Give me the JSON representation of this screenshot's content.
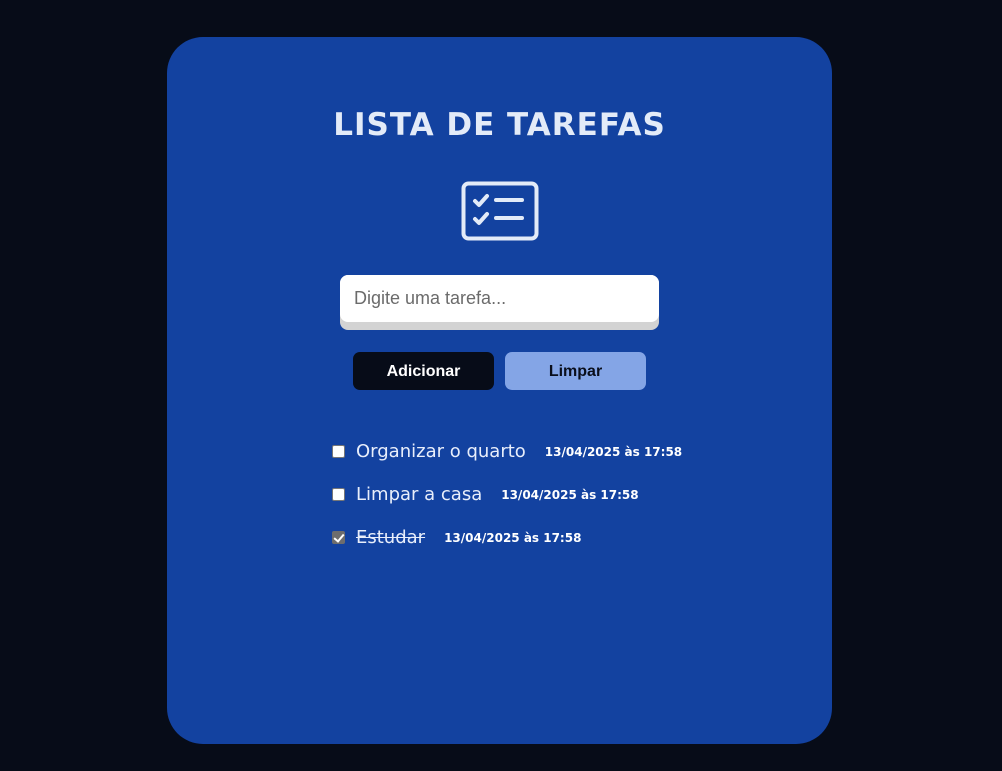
{
  "header": {
    "title": "LISTA DE TAREFAS"
  },
  "logo": {
    "icon": "checklist-icon",
    "color": "#e3ebf8"
  },
  "input": {
    "placeholder": "Digite uma tarefa...",
    "value": ""
  },
  "buttons": {
    "add_label": "Adicionar",
    "clear_label": "Limpar"
  },
  "tasks": [
    {
      "text": "Organizar o quarto",
      "date": "13/04/2025 às 17:58",
      "done": false
    },
    {
      "text": "Limpar a casa",
      "date": "13/04/2025 às 17:58",
      "done": false
    },
    {
      "text": "Estudar",
      "date": "13/04/2025 às 17:58",
      "done": true
    }
  ],
  "colors": {
    "background": "#070c18",
    "card": "#1342a0",
    "add_button": "#070c18",
    "clear_button": "#84a5e6"
  }
}
